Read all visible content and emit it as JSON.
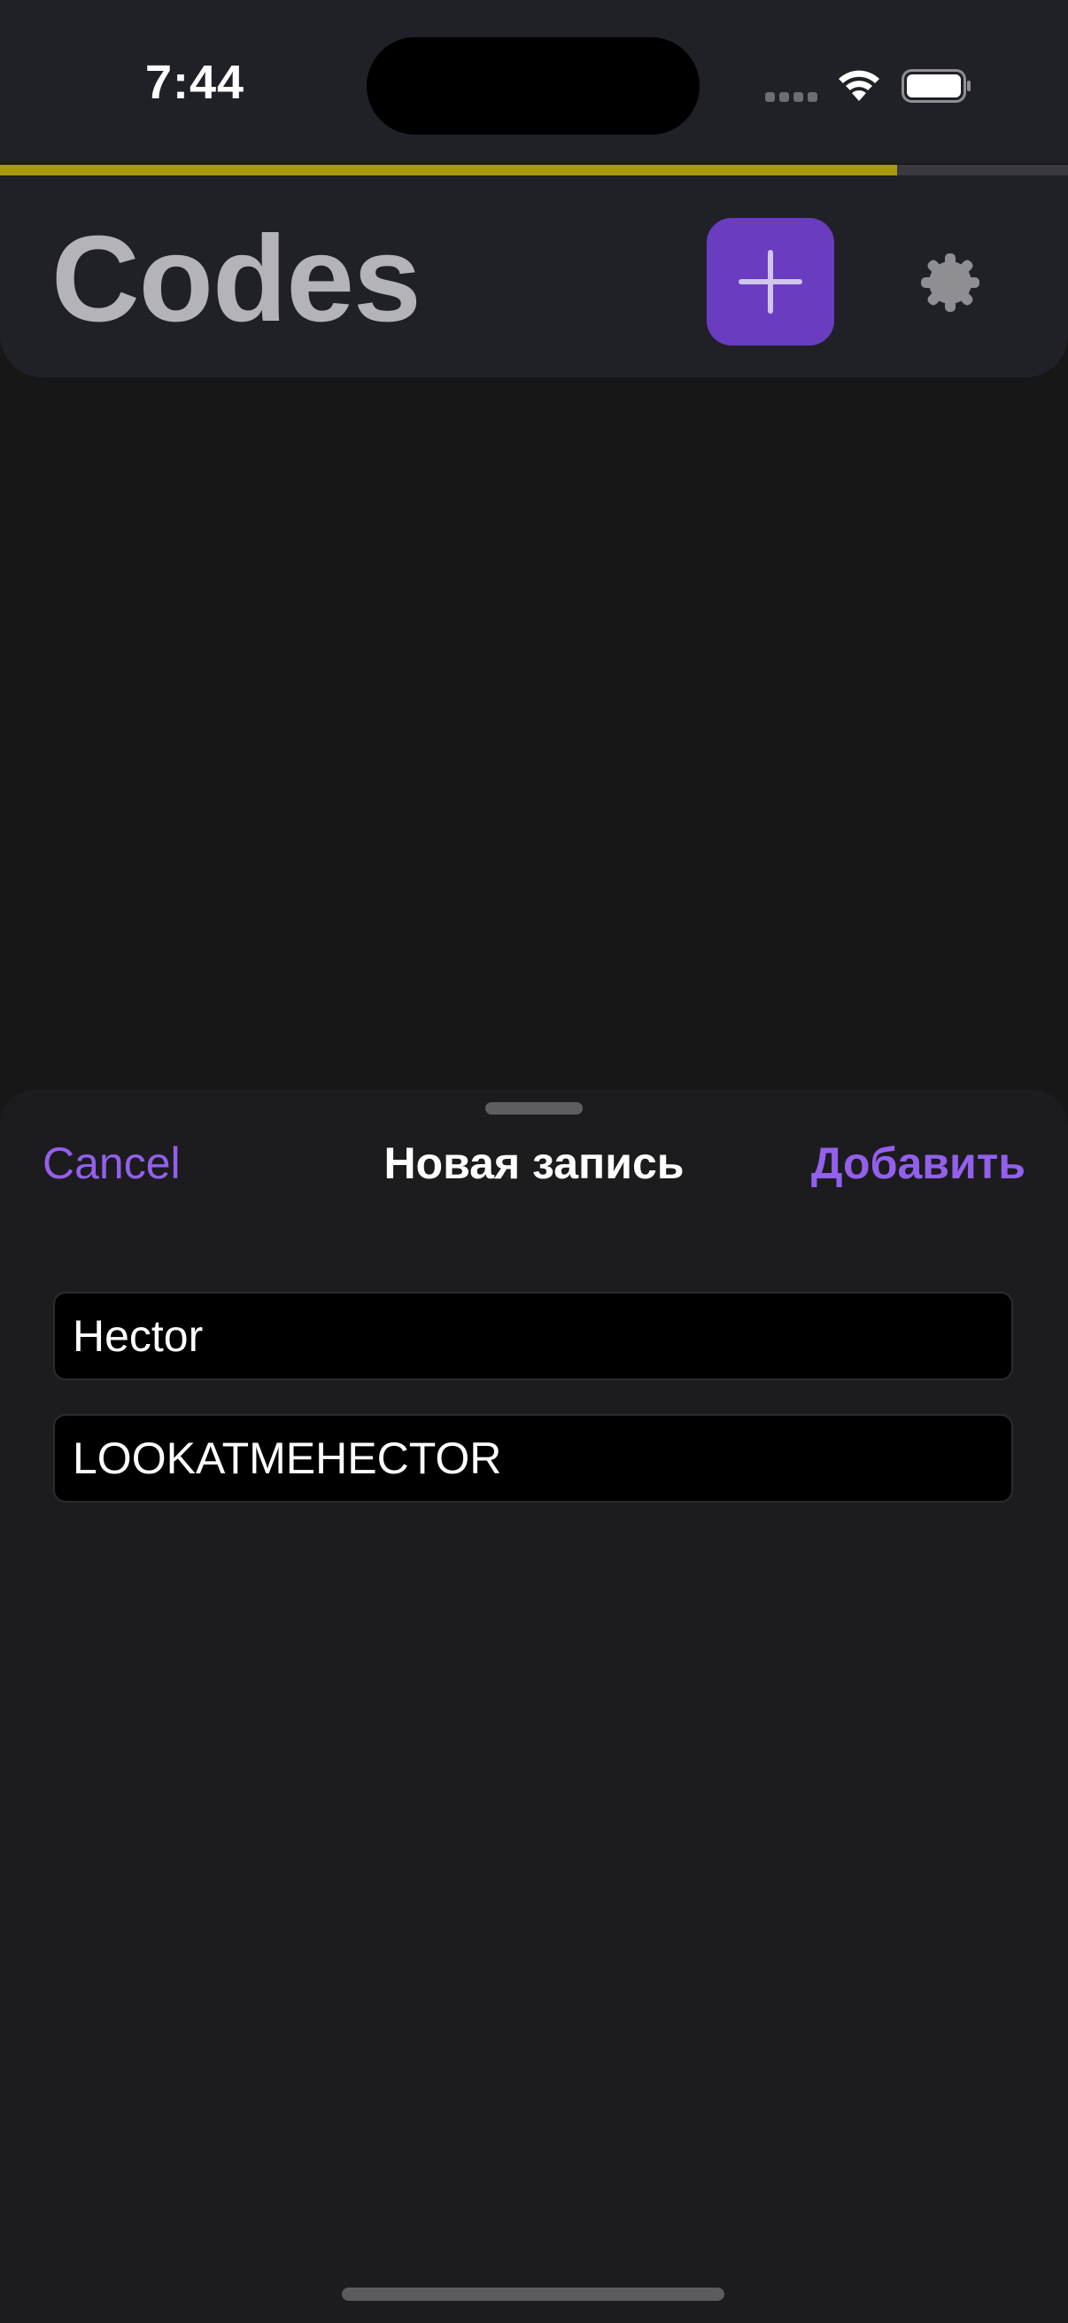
{
  "status_bar": {
    "time": "7:44",
    "cellular_icon": "cellular-dots-icon",
    "wifi_icon": "wifi-icon",
    "battery_icon": "battery-full-icon"
  },
  "timer_progress": {
    "fraction_filled": 0.84,
    "fill_color": "#a99a12",
    "track_color": "#3a3a40"
  },
  "header": {
    "title": "Codes",
    "add_icon": "plus-icon",
    "settings_icon": "gear-icon",
    "accent_color": "#6a3cc0"
  },
  "sheet": {
    "cancel_label": "Cancel",
    "title": "Новая запись",
    "add_label": "Добавить",
    "fields": {
      "name_value": "Hector",
      "secret_value": "LOOKATMEHECTOR"
    },
    "link_color": "#9360ec"
  }
}
